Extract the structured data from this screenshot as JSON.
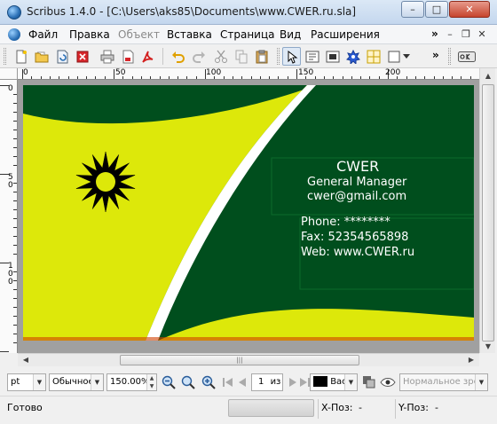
{
  "window": {
    "title": "Scribus 1.4.0 - [C:\\Users\\aks85\\Documents\\www.CWER.ru.sla]",
    "minimize_label": "–",
    "maximize_label": "□",
    "close_label": "✕"
  },
  "menu": {
    "items": [
      {
        "label": "Файл",
        "enabled": true
      },
      {
        "label": "Правка",
        "enabled": true
      },
      {
        "label": "Объект",
        "enabled": false
      },
      {
        "label": "Вставка",
        "enabled": true
      },
      {
        "label": "Страница",
        "enabled": true
      },
      {
        "label": "Вид",
        "enabled": true
      },
      {
        "label": "Расширения",
        "enabled": true
      }
    ],
    "overflow_label": "»",
    "mdi_min": "–",
    "mdi_restore": "❐",
    "mdi_close": "✕"
  },
  "toolbar": {
    "buttons": [
      "new-document-icon",
      "open-icon",
      "recent-icon",
      "close-document-icon",
      "print-icon",
      "preflight-icon",
      "export-pdf-icon",
      "undo-icon",
      "redo-icon",
      "cut-icon",
      "copy-icon",
      "paste-icon",
      "select-tool-icon",
      "text-frame-icon",
      "image-frame-icon",
      "render-frame-icon",
      "table-icon",
      "shape-icon",
      "unlink-icon"
    ],
    "overflow_label": "»",
    "right_button": "ok-icon"
  },
  "rulers": {
    "top_labels": [
      "0",
      "50",
      "100",
      "150",
      "200"
    ],
    "left_labels": [
      "0",
      "50",
      "100"
    ]
  },
  "card": {
    "name": "CWER",
    "role": "General Manager",
    "email": "cwer@gmail.com",
    "phone": "Phone: ********",
    "fax": "Fax: 52354565898",
    "web": "Web: www.CWER.ru",
    "colors": {
      "dark_green": "#004e1d",
      "yellow_green": "#dde80a",
      "white": "#ffffff",
      "star": "#000000"
    }
  },
  "bottom": {
    "unit": "pt",
    "mode": "Обычное",
    "zoom": "150.00%",
    "page_number": "1",
    "page_of": "из",
    "layer": "Вас",
    "view_mode": "Нормальное зрение",
    "hscroll_grip": "|||"
  },
  "status": {
    "text": "Готово",
    "x_label": "X-Поз:",
    "x_value": "-",
    "y_label": "Y-Поз:",
    "y_value": "-"
  }
}
